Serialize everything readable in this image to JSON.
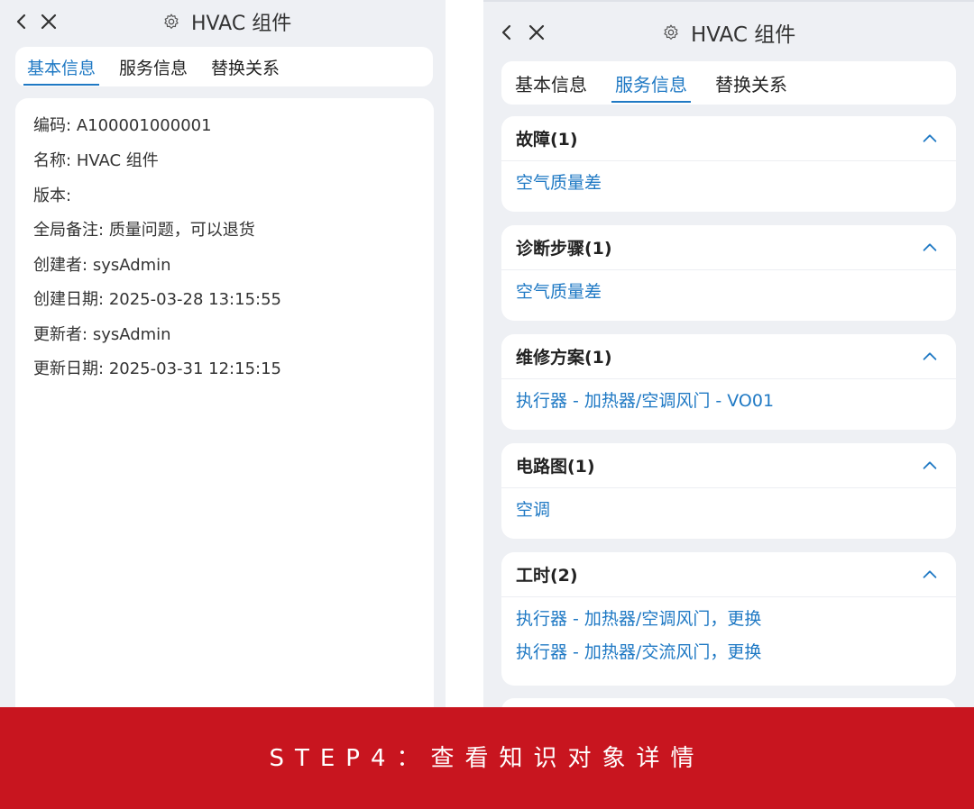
{
  "left": {
    "header": {
      "title": "HVAC 组件"
    },
    "tabs": [
      "基本信息",
      "服务信息",
      "替换关系"
    ],
    "active_tab": "基本信息",
    "info": [
      {
        "label": "编码:",
        "value": "A100001000001"
      },
      {
        "label": "名称:",
        "value": "HVAC 组件"
      },
      {
        "label": "版本:",
        "value": ""
      },
      {
        "label": "全局备注:",
        "value": "质量问题，可以退货"
      },
      {
        "label": "创建者:",
        "value": "sysAdmin"
      },
      {
        "label": "创建日期:",
        "value": "2025-03-28 13:15:55"
      },
      {
        "label": "更新者:",
        "value": "sysAdmin"
      },
      {
        "label": "更新日期:",
        "value": "2025-03-31 12:15:15"
      }
    ]
  },
  "right": {
    "header": {
      "title": "HVAC 组件"
    },
    "tabs": [
      "基本信息",
      "服务信息",
      "替换关系"
    ],
    "active_tab": "服务信息",
    "sections": [
      {
        "title": "故障(1)",
        "items": [
          "空气质量差"
        ]
      },
      {
        "title": "诊断步骤(1)",
        "items": [
          "空气质量差"
        ]
      },
      {
        "title": "维修方案(1)",
        "items": [
          "执行器 - 加热器/空调风门 - VO01"
        ]
      },
      {
        "title": "电路图(1)",
        "items": [
          "空调"
        ]
      },
      {
        "title": "工时(2)",
        "items": [
          "执行器 - 加热器/空调风门，更换",
          "执行器 - 加热器/交流风门，更换"
        ]
      }
    ]
  },
  "banner": {
    "text": "STEP4：查看知识对象详情"
  },
  "colors": {
    "accent": "#1f79c4",
    "banner": "#c8151f",
    "panel_bg": "#eef0f4"
  }
}
